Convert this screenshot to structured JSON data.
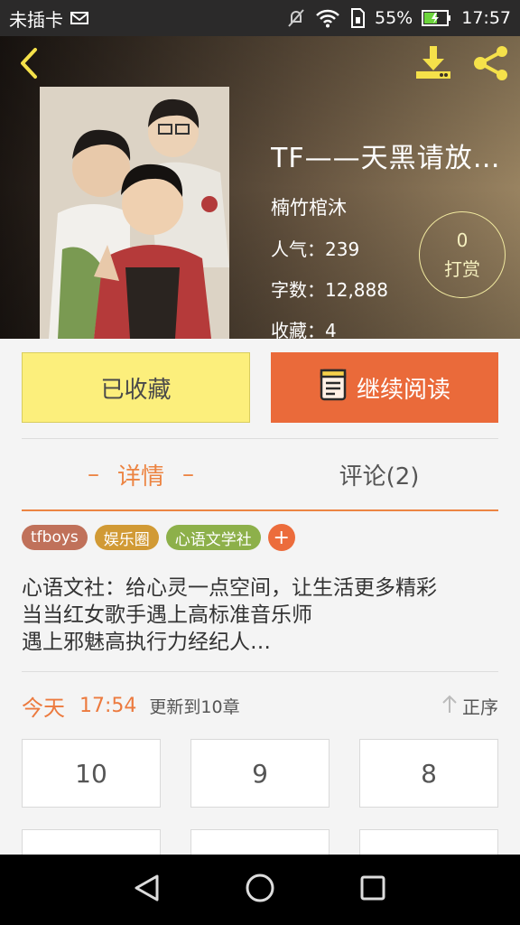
{
  "status_bar": {
    "carrier": "未插卡",
    "battery": "55%",
    "time": "17:57",
    "icons": [
      "mail-icon",
      "mute-icon",
      "wifi-icon",
      "sim-icon",
      "battery-icon"
    ]
  },
  "header": {
    "title": "TF——天黑请放…",
    "author": "楠竹棺沐",
    "popularity_label": "人气：",
    "popularity_value": "239",
    "wordcount_label": "字数：",
    "wordcount_value": "12,888",
    "favorites_label": "收藏：",
    "favorites_value": "4",
    "tip_count": "0",
    "tip_label": "打赏",
    "icons": [
      "back-icon",
      "download-icon",
      "share-icon"
    ]
  },
  "actions": {
    "favorite_label": "已收藏",
    "read_label": "继续阅读"
  },
  "tabs": {
    "detail_label": "详情",
    "detail_dash": "–",
    "comment_label": "评论(2)"
  },
  "tags": [
    {
      "label": "tfboys",
      "color": "#c0715a"
    },
    {
      "label": "娱乐圈",
      "color": "#d19a35"
    },
    {
      "label": "心语文学社",
      "color": "#8db04a"
    }
  ],
  "tag_add": "+",
  "description": [
    "心语文社：给心灵一点空间，让生活更多精彩",
    "当当红女歌手遇上高标准音乐师",
    "遇上邪魅高执行力经纪人…"
  ],
  "update": {
    "today": "今天",
    "time": "17:54",
    "text": "更新到10章",
    "sort_label": "正序"
  },
  "chapters": [
    "10",
    "9",
    "8",
    "",
    "",
    ""
  ],
  "colors": {
    "accent": "#ec8442",
    "read_button": "#ea6a3a",
    "favorite_button": "#fcef7c"
  }
}
